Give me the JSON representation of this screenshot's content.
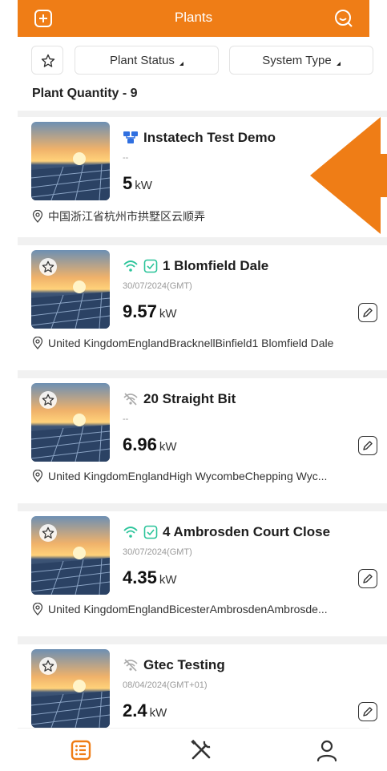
{
  "header": {
    "title": "Plants"
  },
  "filters": {
    "status_label": "Plant Status",
    "type_label": "System Type"
  },
  "summary": {
    "quantity_label": "Plant Quantity - 9"
  },
  "colors": {
    "brand": "#ef7d16",
    "muted": "#9a9a9a",
    "online": "#2bc49a"
  },
  "plants": [
    {
      "name": "Instatech Test Demo",
      "date": "--",
      "power": "5",
      "unit": "kW",
      "address": "中国浙江省杭州市拱墅区云顺弄",
      "status_icon": "gateway-icon"
    },
    {
      "name": "1 Blomfield Dale",
      "date": "30/07/2024(GMT)",
      "power": "9.57",
      "unit": "kW",
      "address": "United KingdomEnglandBracknellBinfield1 Blomfield Dale",
      "status_icon": "wifi-online-icon"
    },
    {
      "name": "20 Straight Bit",
      "date": "--",
      "power": "6.96",
      "unit": "kW",
      "address": "United KingdomEnglandHigh WycombeChepping Wyc...",
      "status_icon": "wifi-offline-icon"
    },
    {
      "name": "4 Ambrosden Court Close",
      "date": "30/07/2024(GMT)",
      "power": "4.35",
      "unit": "kW",
      "address": "United KingdomEnglandBicesterAmbrosdenAmbrosde...",
      "status_icon": "wifi-online-icon"
    },
    {
      "name": "Gtec Testing",
      "date": "08/04/2024(GMT+01)",
      "power": "2.4",
      "unit": "kW",
      "address": "",
      "status_icon": "wifi-offline-icon"
    }
  ],
  "tabs": [
    {
      "name": "plants",
      "icon": "list-icon",
      "active": true
    },
    {
      "name": "tools",
      "icon": "tools-icon",
      "active": false
    },
    {
      "name": "me",
      "icon": "user-icon",
      "active": false
    }
  ]
}
